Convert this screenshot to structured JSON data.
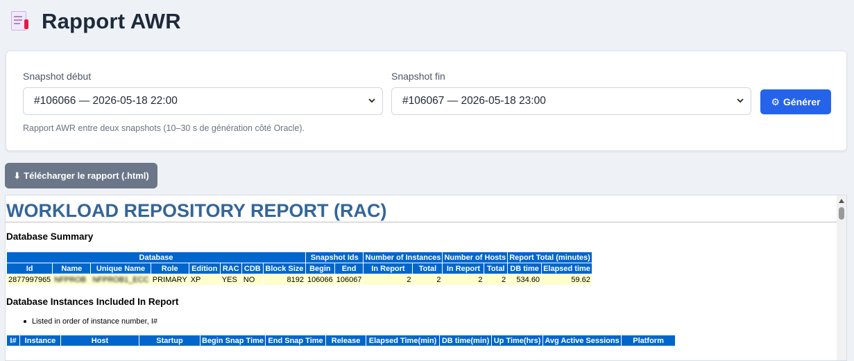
{
  "header": {
    "title": "Rapport AWR",
    "icon": "document-icon"
  },
  "form": {
    "start": {
      "label": "Snapshot début",
      "value": "#106066 — 2026-05-18 22:00"
    },
    "end": {
      "label": "Snapshot fin",
      "value": "#106067 — 2026-05-18 23:00"
    },
    "generate_label": "Générer",
    "hint": "Rapport AWR entre deux snapshots (10–30 s de génération côté Oracle)."
  },
  "download_label": "Télécharger le rapport (.html)",
  "report": {
    "title": "WORKLOAD REPOSITORY REPORT (RAC)",
    "db_summary_heading": "Database Summary",
    "db_summary": {
      "group_headers": [
        "Database",
        "Snapshot Ids",
        "Number of Instances",
        "Number of Hosts",
        "Report Total (minutes)"
      ],
      "headers": [
        "Id",
        "Name",
        "Unique Name",
        "Role",
        "Edition",
        "RAC",
        "CDB",
        "Block Size",
        "Begin",
        "End",
        "In Report",
        "Total",
        "In Report",
        "Total",
        "DB time",
        "Elapsed time"
      ],
      "row": [
        "2877997965",
        "NFPROB",
        "NFPROB1_ECC",
        "PRIMARY",
        "XP",
        "YES",
        "NO",
        "8192",
        "106066",
        "106067",
        "2",
        "2",
        "2",
        "2",
        "534.60",
        "59.62"
      ]
    },
    "instances_heading": "Database Instances Included In Report",
    "instances_note": "Listed in order of instance number, I#",
    "instances": {
      "headers": [
        "I#",
        "Instance",
        "Host",
        "Startup",
        "Begin Snap Time",
        "End Snap Time",
        "Release",
        "Elapsed Time(min)",
        "DB time(min)",
        "Up Time(hrs)",
        "Avg Active Sessions",
        "Platform"
      ]
    }
  },
  "colors": {
    "accent": "#2563eb",
    "awr_header": "#0066cc",
    "awr_cell": "#ffffcc",
    "awr_title": "#336699"
  }
}
